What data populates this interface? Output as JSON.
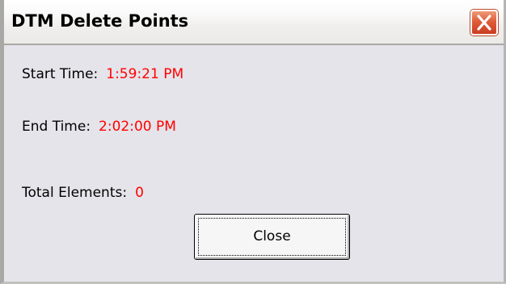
{
  "window": {
    "title": "DTM Delete Points",
    "close_icon": "close-x-icon"
  },
  "fields": {
    "start_time_label": "Start Time:",
    "start_time_value": "1:59:21 PM",
    "end_time_label": "End Time:",
    "end_time_value": "2:02:00 PM",
    "total_elements_label": "Total Elements:",
    "total_elements_value": "0"
  },
  "buttons": {
    "close_label": "Close"
  },
  "colors": {
    "value_text": "#ff0000",
    "dialog_background": "#e5e4ea",
    "title_close_button": "#e15c3a"
  }
}
